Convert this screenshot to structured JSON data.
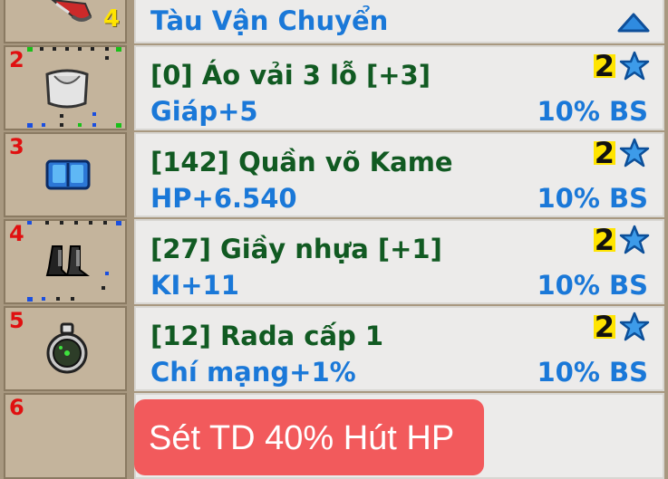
{
  "header": {
    "title": "Tàu Vận Chuyển",
    "count": "4"
  },
  "items": [
    {
      "slot": "2",
      "name": "[0] Áo vải 3 lỗ [+3]",
      "stat": "Giáp+5",
      "stars": "2",
      "bs": "10% BS",
      "icon": "shirt-icon"
    },
    {
      "slot": "3",
      "name": "[142] Quần võ Kame",
      "stat": "HP+6.540",
      "stars": "2",
      "bs": "10% BS",
      "icon": "pants-icon"
    },
    {
      "slot": "4",
      "name": "[27] Giầy nhựa [+1]",
      "stat": "KI+11",
      "stars": "2",
      "bs": "10% BS",
      "icon": "boots-icon"
    },
    {
      "slot": "5",
      "name": "[12] Rada cấp 1",
      "stat": "Chí mạng+1%",
      "stars": "2",
      "bs": "10% BS",
      "icon": "radar-icon"
    }
  ],
  "last_slot": {
    "slot": "6",
    "bonus": "Sét TD 40% Hút HP"
  },
  "colors": {
    "name": "#115a22",
    "stat": "#1a78d8",
    "slot_number": "#e01010",
    "bonus_bg": "#f25a5c"
  }
}
